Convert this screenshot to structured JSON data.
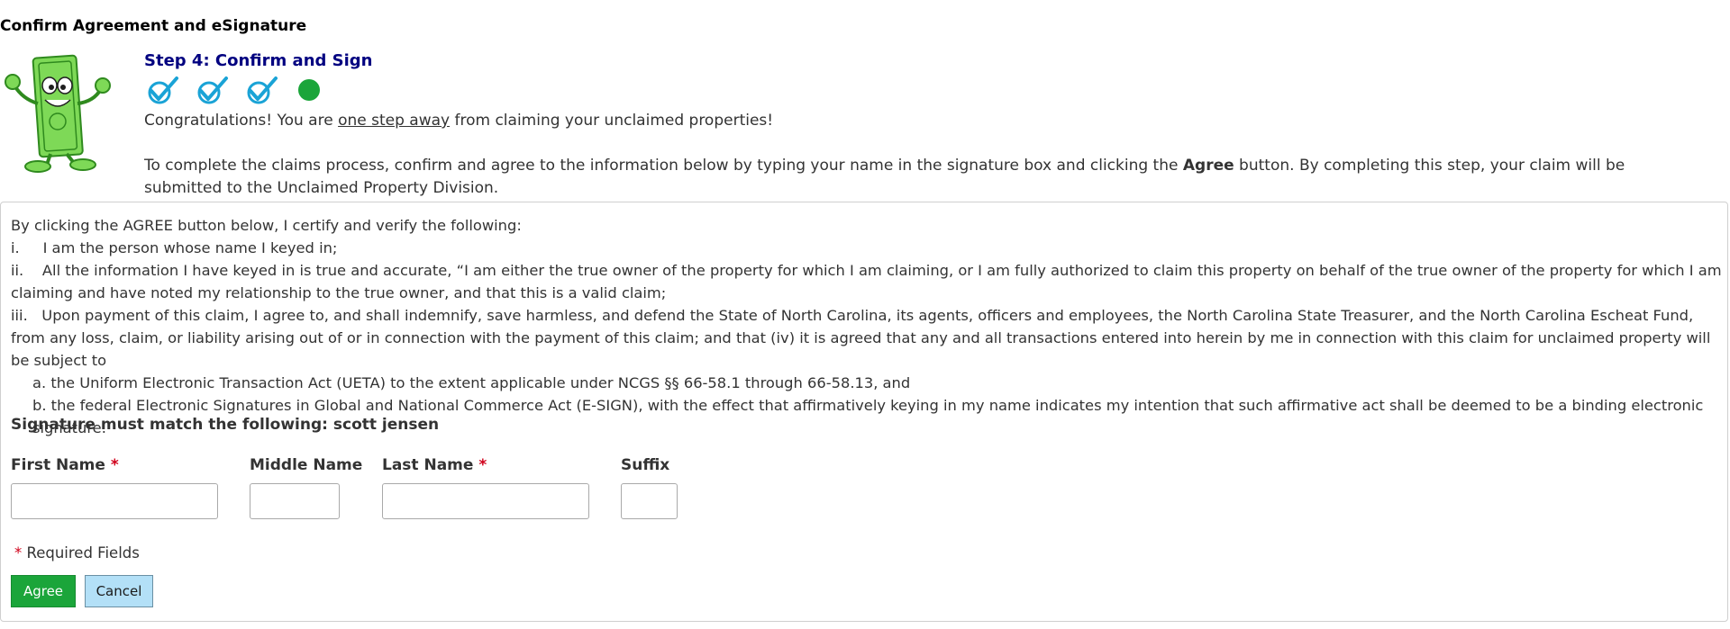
{
  "page": {
    "title": "Confirm Agreement and eSignature"
  },
  "step": {
    "title": "Step 4: Confirm and Sign",
    "progress_icons": [
      "check-icon",
      "check-icon",
      "check-icon",
      "current-step-dot-icon"
    ],
    "colors": {
      "check": "#1aa3d6",
      "current": "#1ba53a",
      "title": "#000080"
    }
  },
  "intro": {
    "line1_before": "Congratulations! You are ",
    "line1_link": "one step away",
    "line1_after": " from claiming your unclaimed properties!",
    "line2_before": "To complete the claims process, confirm and agree to the information below by typing your name in the signature box and clicking the ",
    "line2_bold": "Agree",
    "line2_after": " button. By completing this step, your claim will be submitted to the Unclaimed Property Division."
  },
  "agreement": {
    "heading": "By clicking the AGREE button below, I certify and verify the following:",
    "item_i": "i.     I am the person whose name I keyed in;",
    "item_ii": "ii.    All the information I have keyed in is true and accurate, “I am either the true owner of the property for which I am claiming, or I am fully authorized to claim this property on behalf of the true owner of the property for which I am claiming and have noted my relationship to the true owner, and that this is a valid claim;",
    "item_iii": "iii.   Upon payment of this claim, I agree to, and shall indemnify, save harmless, and defend the State of North Carolina, its agents, officers and employees, the North Carolina State Treasurer, and the North Carolina Escheat Fund, from any loss, claim, or liability arising out of or in connection with the payment of this claim; and that (iv) it is agreed that any and all transactions entered into herein by me in connection with this claim for unclaimed property will be subject to",
    "item_a": "a. the Uniform Electronic Transaction Act (UETA) to the extent applicable under NCGS §§ 66-58.1 through 66-58.13, and",
    "item_b": "b. the federal Electronic Signatures in Global and National Commerce Act (E-SIGN), with the effect that affirmatively keying in my name indicates my intention that such affirmative act shall be deemed to be a binding electronic signature."
  },
  "signature": {
    "match_text": "Signature must match the following: scott jensen",
    "first_name_label": "First Name",
    "middle_name_label": "Middle Name",
    "last_name_label": "Last Name",
    "suffix_label": "Suffix",
    "required_mark": "*",
    "first_name_value": "",
    "middle_name_value": "",
    "last_name_value": "",
    "suffix_value": "",
    "required_note": "Required Fields"
  },
  "buttons": {
    "agree_label": "Agree",
    "cancel_label": "Cancel",
    "agree_color": "#1ba53a",
    "cancel_color": "#b3e0f7"
  }
}
